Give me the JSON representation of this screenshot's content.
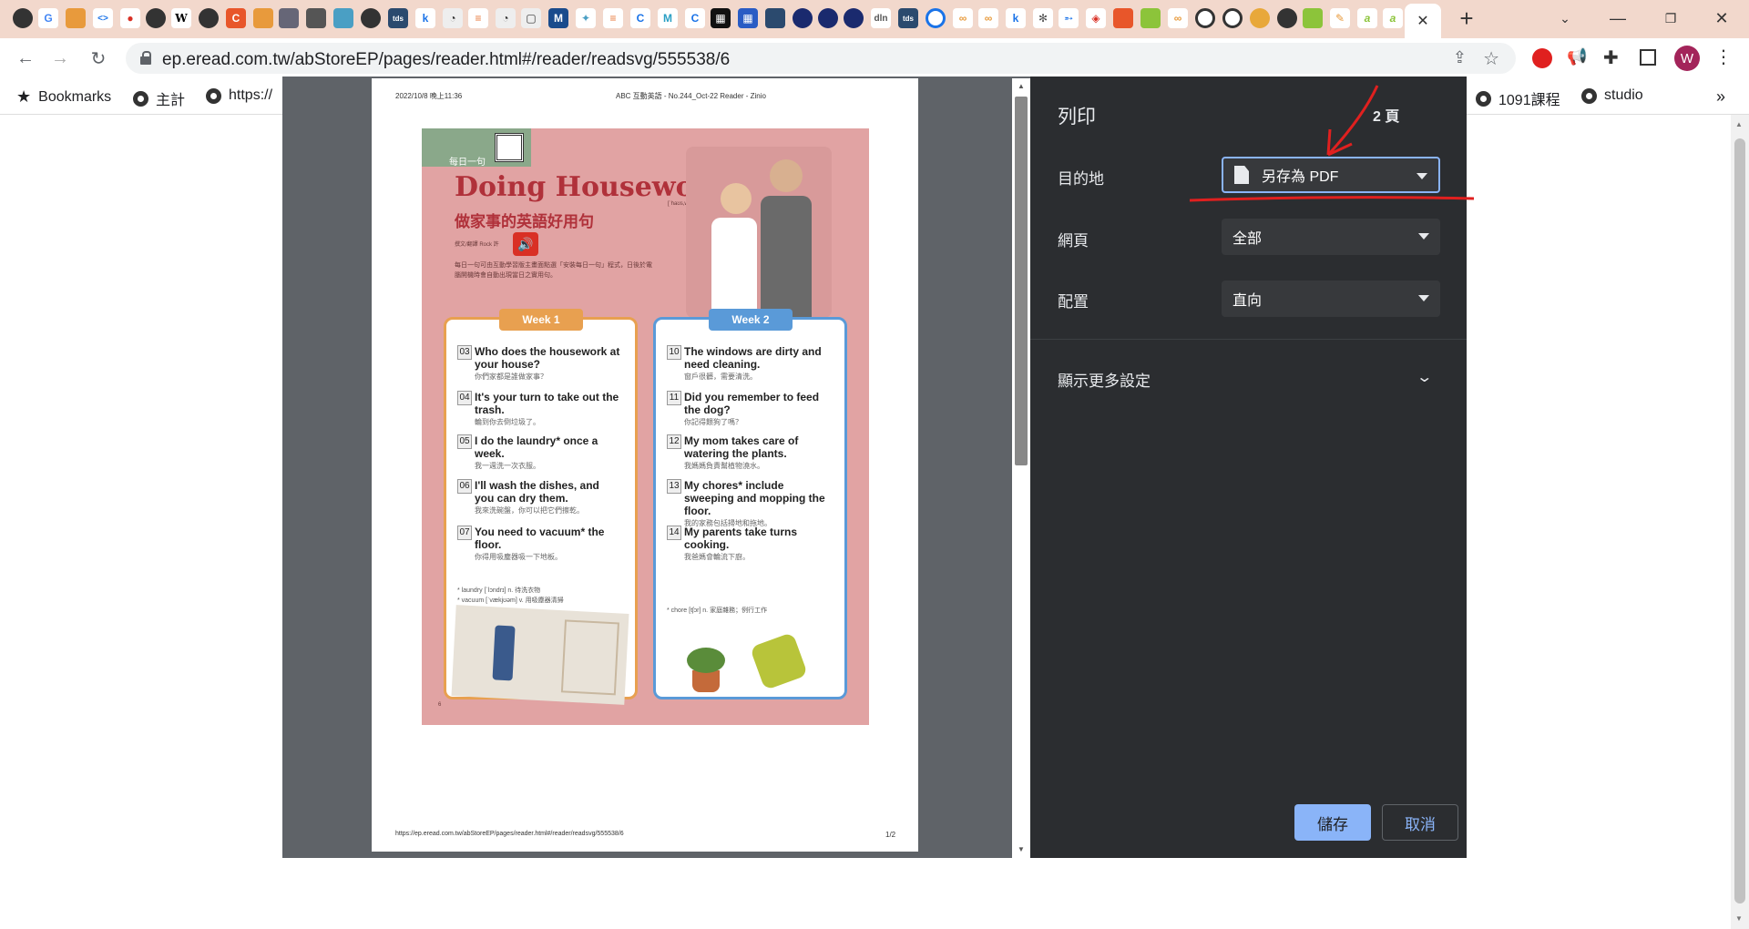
{
  "browser": {
    "url": "ep.eread.com.tw/abStoreEP/pages/reader.html#/reader/readsvg/555538/6",
    "profile_initial": "W",
    "tab_close_glyph": "✕",
    "new_tab_glyph": "+"
  },
  "bookmarks": {
    "label": "Bookmarks",
    "items": [
      "主計",
      "https://",
      "1091課程",
      "studio"
    ],
    "more": "»"
  },
  "preview": {
    "header_left": "2022/10/8 晚上11:36",
    "header_center": "ABC 互動英語 - No.244_Oct-22 Reader - Zinio",
    "footer_left": "https://ep.eread.com.tw/abStoreEP/pages/reader.html#/reader/readsvg/555538/6",
    "footer_right": "1/2",
    "page_number": "6",
    "magazine": {
      "banner": "每日一句",
      "title": "Doing Housework",
      "phonetic": "[ˈhaʊs,wɝk]",
      "subtitle": "做家事的英語好用句",
      "author": "撰文/翻譯 Rock 許",
      "intro": "每日一句可由互動學習版主畫面點選「安裝每日一句」程式，日後於電腦開機時會自動出現當日之實用句。",
      "week1": "Week 1",
      "week2": "Week 2",
      "week1_items": [
        {
          "num": "03",
          "en": "Who does the housework at your house?",
          "zh": "你們家都是誰做家事？"
        },
        {
          "num": "04",
          "en": "It's your turn to take out the trash.",
          "zh": "輪到你去倒垃圾了。"
        },
        {
          "num": "05",
          "en": "I do the laundry* once a week.",
          "zh": "我一週洗一次衣服。"
        },
        {
          "num": "06",
          "en": "I'll wash the dishes, and you can dry them.",
          "zh": "我來洗碗盤，你可以把它們擦乾。"
        },
        {
          "num": "07",
          "en": "You need to vacuum* the floor.",
          "zh": "你得用吸塵器吸一下地板。"
        }
      ],
      "week1_notes": [
        "* laundry [ˈlɔndrɪ] n. 待洗衣物",
        "* vacuum [ˈvækjʊəm] v. 用吸塵器清掃"
      ],
      "week2_items": [
        {
          "num": "10",
          "en": "The windows are dirty and need cleaning.",
          "zh": "窗戶很髒，需要清洗。"
        },
        {
          "num": "11",
          "en": "Did you remember to feed the dog?",
          "zh": "你記得餵狗了嗎？"
        },
        {
          "num": "12",
          "en": "My mom takes care of watering the plants.",
          "zh": "我媽媽負責幫植物澆水。"
        },
        {
          "num": "13",
          "en": "My chores* include sweeping and mopping the floor.",
          "zh": "我的家務包括掃地和拖地。"
        },
        {
          "num": "14",
          "en": "My parents take turns cooking.",
          "zh": "我爸媽會輪流下廚。"
        }
      ],
      "week2_notes": [
        "* chore [tʃɔr] n. 家庭雜務；例行工作"
      ]
    }
  },
  "print": {
    "title": "列印",
    "pages_count": "2 頁",
    "destination_label": "目的地",
    "destination_value": "另存為 PDF",
    "pages_label": "網頁",
    "pages_value": "全部",
    "layout_label": "配置",
    "layout_value": "直向",
    "more_settings": "顯示更多設定",
    "save": "儲存",
    "cancel": "取消"
  },
  "colors": {
    "accent": "#8ab4f8",
    "annotation": "#e0201f",
    "panel_bg": "#2b2d30"
  }
}
